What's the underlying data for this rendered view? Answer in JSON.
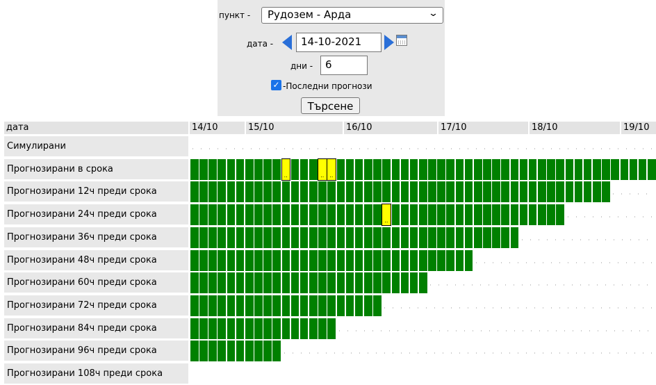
{
  "form": {
    "station_label": "пункт -",
    "station_value": "Рудозем - Арда",
    "date_label": "дата -",
    "date_value": "14-10-2021",
    "days_label": "дни -",
    "days_value": "6",
    "latest_label": "-Последни прогнози",
    "latest_checked": true,
    "search_button": "Търсене"
  },
  "grid": {
    "header_label": "дата",
    "date_columns": [
      "14/10",
      "15/10",
      "16/10",
      "17/10",
      "18/10",
      "19/10"
    ],
    "row_labels": [
      "Симулирани",
      "Прогнозирани в срока",
      "Прогнозирани 12ч преди срока",
      "Прогнозирани 24ч преди срока",
      "Прогнозирани 36ч преди срока",
      "Прогнозирани 48ч преди срока",
      "Прогнозирани 60ч преди срока",
      "Прогнозирани 72ч преди срока",
      "Прогнозирани 84ч преди срока",
      "Прогнозирани 96ч преди срока",
      "Прогнозирани 108ч преди срока"
    ],
    "row_cell_counts": [
      0,
      51,
      46,
      41,
      36,
      31,
      26,
      21,
      16,
      10,
      0
    ],
    "yellow_cells": [
      [
        1,
        10
      ],
      [
        1,
        14
      ],
      [
        1,
        15
      ],
      [
        3,
        21
      ]
    ],
    "yellow_mark": "..",
    "colors": {
      "ok": "#008000",
      "warning": "#ffff00",
      "label_bg": "#e8e8e8"
    }
  }
}
